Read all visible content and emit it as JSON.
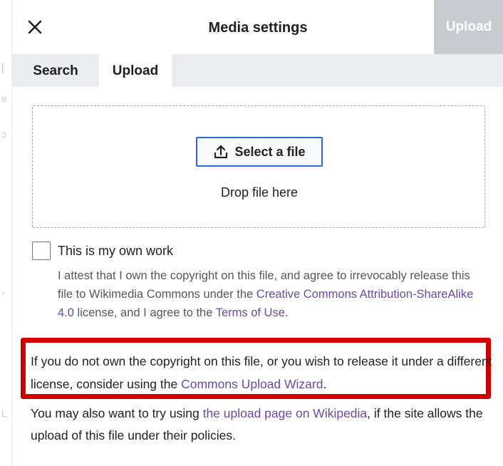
{
  "header": {
    "close_icon": "close-icon",
    "title": "Media settings",
    "upload_button": "Upload"
  },
  "tabs": [
    {
      "label": "Search",
      "active": false
    },
    {
      "label": "Upload",
      "active": true
    }
  ],
  "dropzone": {
    "select_file_icon": "upload-icon",
    "select_file_label": "Select a file",
    "drop_text": "Drop file here"
  },
  "own_work": {
    "checked": false,
    "label": "This is my own work",
    "attest_prefix": "I attest that I own the copyright on this file, and agree to irrevocably release this file to Wikimedia Commons under the ",
    "license_link": "Creative Commons Attribution-ShareAlike 4.0",
    "attest_middle": " license, and I agree to the ",
    "terms_link": "Terms of Use",
    "attest_suffix": "."
  },
  "notice": {
    "prefix": "If you do not own the copyright on this file, or you wish to release it under a different license, consider using the ",
    "wizard_link": "Commons Upload Wizard",
    "suffix": "."
  },
  "also": {
    "prefix": "You may also want to try using ",
    "wiki_link": "the upload page on Wikipedia",
    "suffix": ", if the site allows the upload of this file under their policies."
  },
  "colors": {
    "accent_blue": "#3366cc",
    "link_purple": "#6b4ba1",
    "highlight_red": "#cc0000",
    "disabled_gray": "#c8ccd1",
    "tabbar_gray": "#eaecf0"
  }
}
